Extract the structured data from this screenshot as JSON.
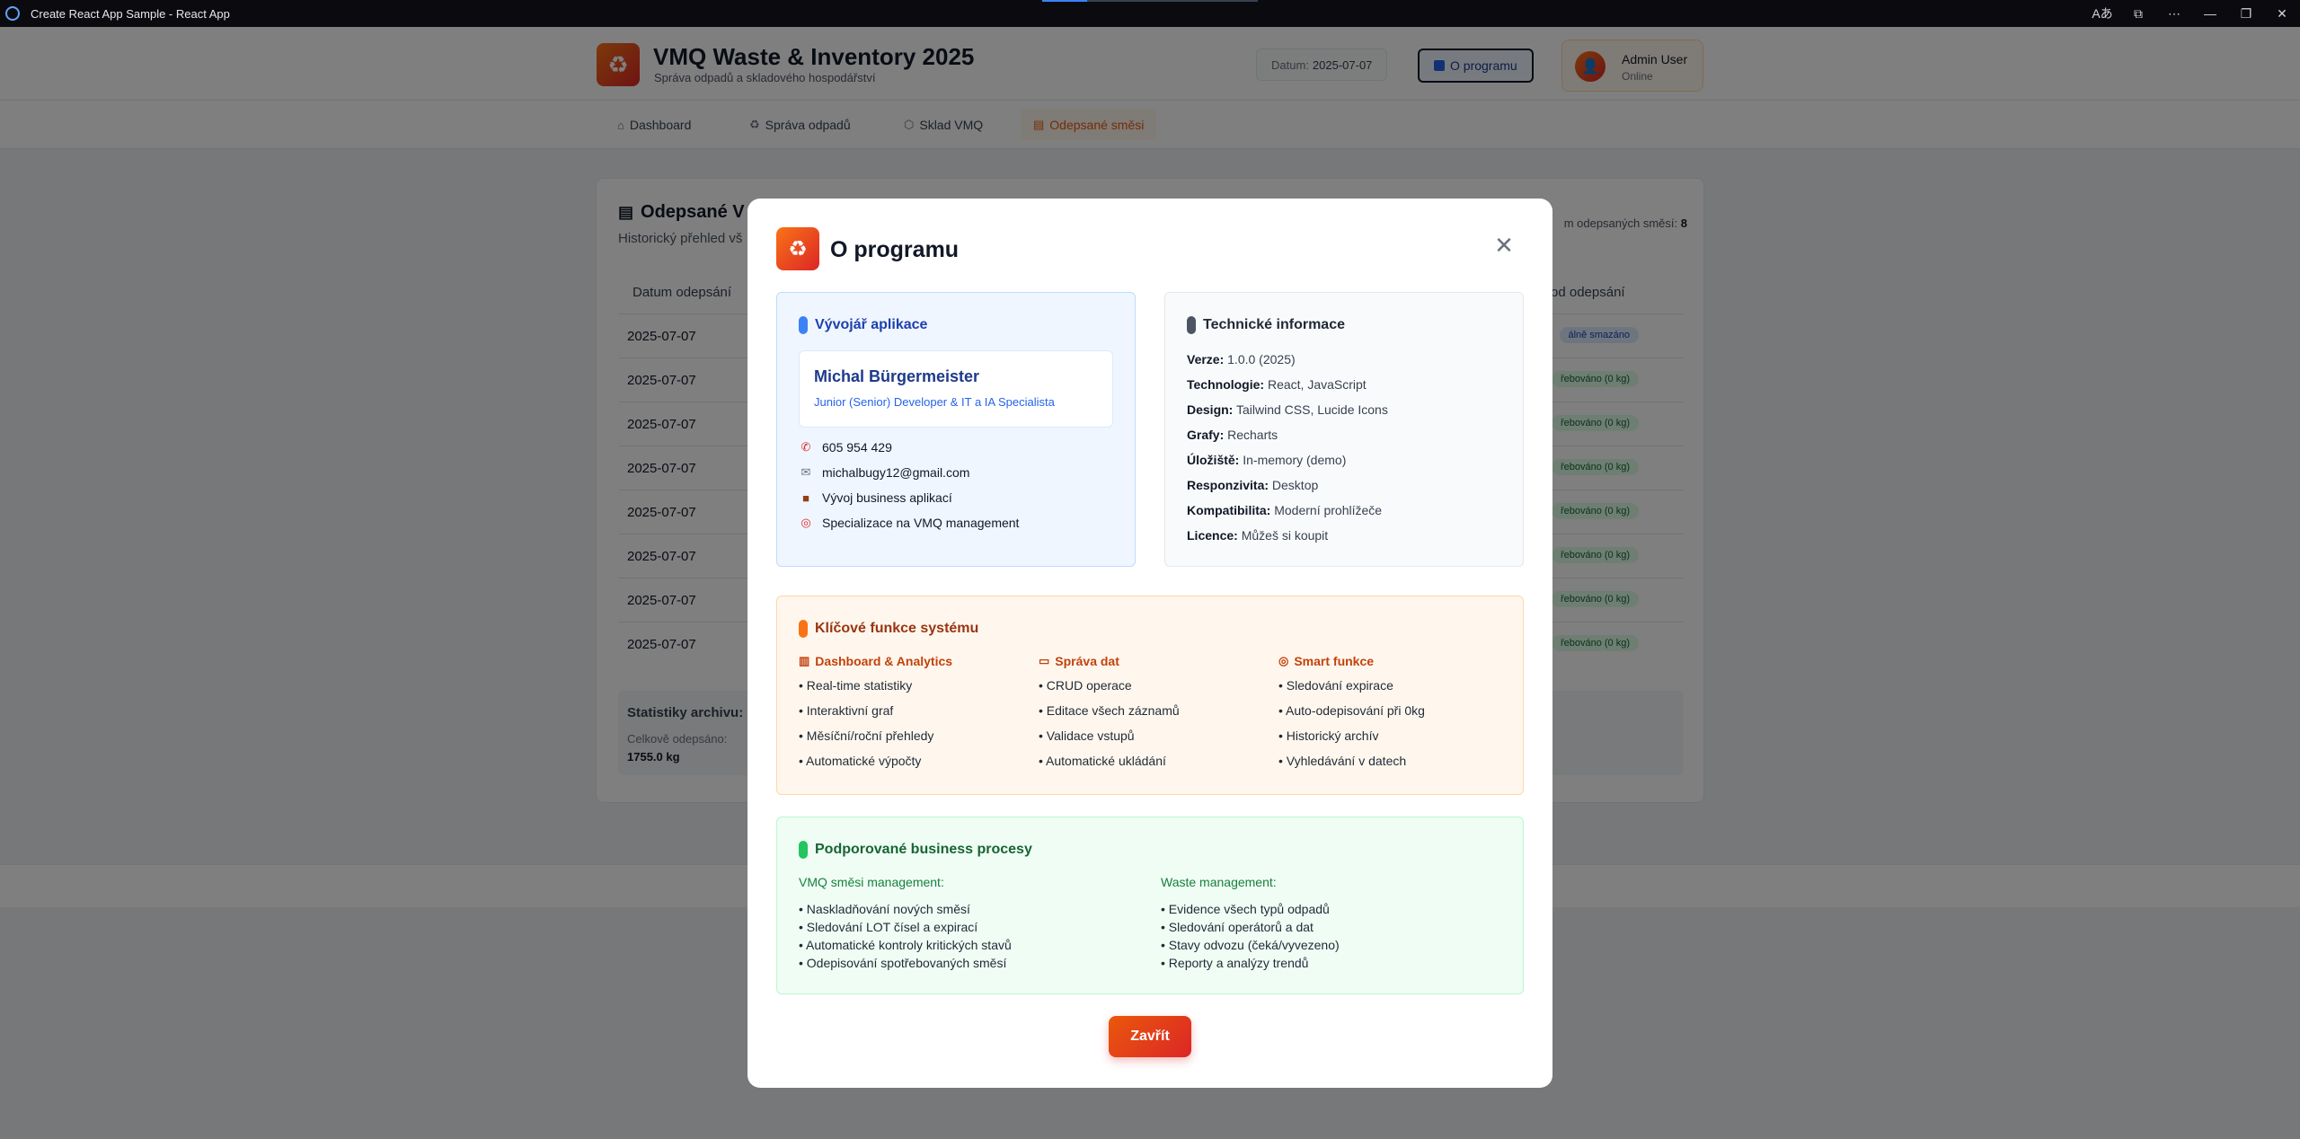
{
  "window": {
    "title": "Create React App Sample - React App"
  },
  "header": {
    "title": "VMQ Waste & Inventory 2025",
    "subtitle": "Správa odpadů a skladového hospodářství",
    "date_label": "Datum:",
    "date_value": "2025-07-07",
    "about_label": "O programu",
    "user_name": "Admin User",
    "user_status": "Online"
  },
  "tabs": [
    {
      "label": "Dashboard",
      "icon": "home-icon"
    },
    {
      "label": "Správa odpadů",
      "icon": "recycle-icon"
    },
    {
      "label": "Sklad VMQ",
      "icon": "package-icon"
    },
    {
      "label": "Odepsané směsi",
      "icon": "archive-icon",
      "active": true
    }
  ],
  "background": {
    "title": "Odepsané V",
    "subtitle": "Historický přehled vš",
    "count_label": "m odepsaných směsí:",
    "count_value": "8",
    "col_date": "Datum odepsání",
    "col_reason": "od odepsání",
    "rows": [
      {
        "date": "2025-07-07",
        "badge": "álně smazáno"
      },
      {
        "date": "2025-07-07",
        "badge": "řebováno (0 kg)"
      },
      {
        "date": "2025-07-07",
        "badge": "řebováno (0 kg)"
      },
      {
        "date": "2025-07-07",
        "badge": "řebováno (0 kg)"
      },
      {
        "date": "2025-07-07",
        "badge": "řebováno (0 kg)"
      },
      {
        "date": "2025-07-07",
        "badge": "řebováno (0 kg)"
      },
      {
        "date": "2025-07-07",
        "badge": "řebováno (0 kg)"
      },
      {
        "date": "2025-07-07",
        "badge": "řebováno (0 kg)"
      }
    ],
    "stats_title": "Statistiky archivu:",
    "stats_label": "Celkově odepsáno:",
    "stats_value": "1755.0 kg"
  },
  "modal": {
    "title": "O programu",
    "close_label": "Zavřít",
    "developer": {
      "heading": "Vývojář aplikace",
      "name": "Michal Bürgermeister",
      "role": "Junior (Senior) Developer & IT a IA Specialista",
      "phone": "605 954 429",
      "email": "michalbugy12@gmail.com",
      "item1": "Vývoj business aplikací",
      "item2": "Specializace na VMQ management"
    },
    "tech": {
      "heading": "Technické informace",
      "rows": [
        {
          "label": "Verze:",
          "value": "1.0.0 (2025)"
        },
        {
          "label": "Technologie:",
          "value": "React, JavaScript"
        },
        {
          "label": "Design:",
          "value": "Tailwind CSS, Lucide Icons"
        },
        {
          "label": "Grafy:",
          "value": "Recharts"
        },
        {
          "label": "Úložiště:",
          "value": "In-memory (demo)"
        },
        {
          "label": "Responzivita:",
          "value": "Desktop"
        },
        {
          "label": "Kompatibilita:",
          "value": "Moderní prohlížeče"
        },
        {
          "label": "Licence:",
          "value": "Můžeš si koupit"
        }
      ]
    },
    "features": {
      "heading": "Klíčové funkce systému",
      "columns": [
        {
          "title": "Dashboard & Analytics",
          "icon": "chart-icon",
          "items": [
            "• Real-time statistiky",
            "• Interaktivní graf",
            "• Měsíční/roční přehledy",
            "• Automatické výpočty"
          ]
        },
        {
          "title": "Správa dat",
          "icon": "card-icon",
          "items": [
            "• CRUD operace",
            "• Editace všech záznamů",
            "• Validace vstupů",
            "• Automatické ukládání"
          ]
        },
        {
          "title": "Smart funkce",
          "icon": "target-icon",
          "items": [
            "• Sledování expirace",
            "• Auto-odepisování při 0kg",
            "• Historický archív",
            "• Vyhledávání v datech"
          ]
        }
      ]
    },
    "processes": {
      "heading": "Podporované business procesy",
      "columns": [
        {
          "title": "VMQ směsi management:",
          "items": [
            "• Naskladňování nových směsí",
            "• Sledování LOT čísel a expirací",
            "• Automatické kontroly kritických stavů",
            "• Odepisování spotřebovaných směsí"
          ]
        },
        {
          "title": "Waste management:",
          "items": [
            "• Evidence všech typů odpadů",
            "• Sledování operátorů a dat",
            "• Stavy odvozu (čeká/vyvezeno)",
            "• Reporty a analýzy trendů"
          ]
        }
      ]
    }
  }
}
